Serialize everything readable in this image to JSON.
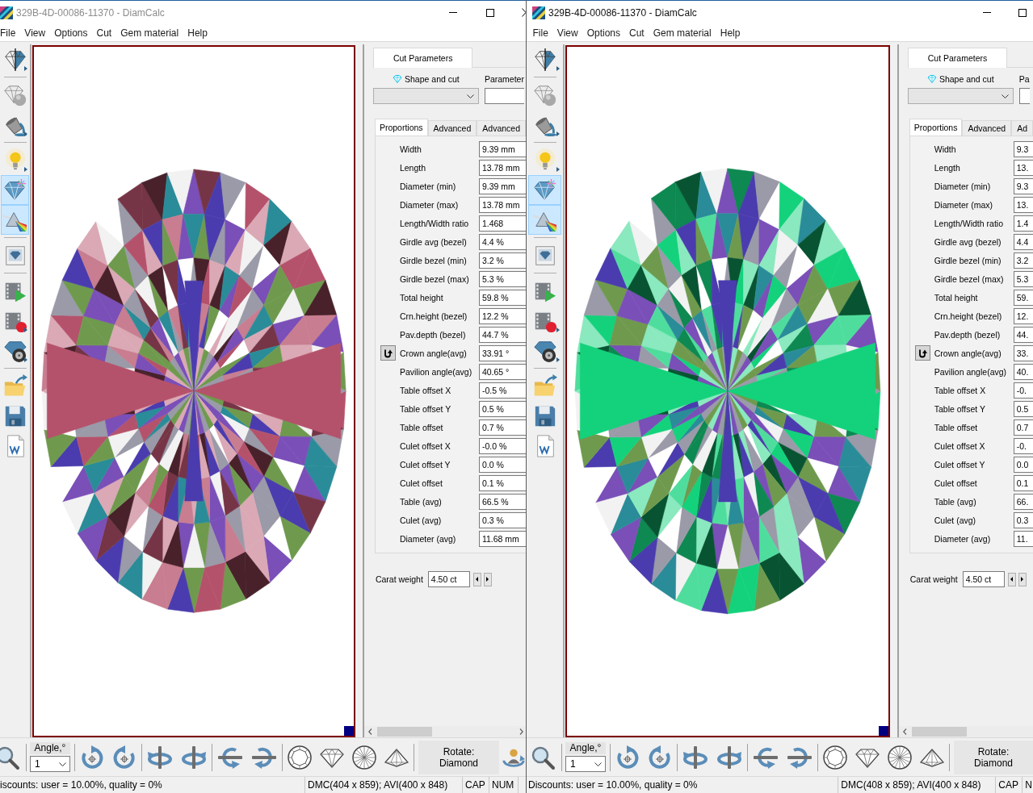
{
  "windows": [
    {
      "title": "329B-4D-00086-11370 - DiamCalc",
      "active": false,
      "menu": [
        "File",
        "View",
        "Options",
        "Cut",
        "Gem material",
        "Help"
      ],
      "tools": [
        {
          "selected": false,
          "menu": true
        },
        {
          "selected": false,
          "menu": false
        },
        {
          "selected": false,
          "menu": true
        },
        {
          "selected": false,
          "menu": true
        },
        {
          "selected": true,
          "menu": false
        },
        {
          "selected": true,
          "menu": false
        },
        {
          "selected": false,
          "menu": false
        },
        {
          "selected": false,
          "menu": false
        },
        {
          "selected": false,
          "menu": true
        },
        {
          "selected": false,
          "menu": true
        },
        {
          "selected": false,
          "menu": false
        },
        {
          "selected": false,
          "menu": false
        },
        {
          "selected": false,
          "menu": false
        }
      ],
      "view": {
        "color": "#b5526b"
      },
      "panel": {
        "top_tabs": [
          {
            "label": "Cut Parameters",
            "selected": true
          }
        ],
        "shape_label": "Shape and cut",
        "parameter_label": "Parameter",
        "tabs": [
          {
            "label": "Proportions",
            "selected": true
          },
          {
            "label": "Advanced",
            "selected": false
          },
          {
            "label": "Advanced",
            "selected": false
          }
        ],
        "rows": [
          {
            "kind": "field",
            "label": "Width",
            "value": "9.39 mm"
          },
          {
            "kind": "field",
            "label": "Length",
            "value": "13.78 mm"
          },
          {
            "kind": "field",
            "label": "Diameter (min)",
            "value": "9.39 mm"
          },
          {
            "kind": "field",
            "label": "Diameter (max)",
            "value": "13.78 mm"
          },
          {
            "kind": "field",
            "label": "Length/Width ratio",
            "value": "1.468"
          },
          {
            "kind": "field",
            "label": "Girdle avg (bezel)",
            "value": "4.4 %"
          },
          {
            "kind": "field",
            "label": "Girdle bezel (min)",
            "value": "3.2 %"
          },
          {
            "kind": "field",
            "label": "Girdle bezel (max)",
            "value": "5.3 %"
          },
          {
            "kind": "field",
            "label": "Total height",
            "value": "59.8 %"
          },
          {
            "kind": "field",
            "label": "Crn.height (bezel)",
            "value": "12.2 %"
          },
          {
            "kind": "field",
            "label": "Pav.depth (bezel)",
            "value": "44.7 %"
          },
          {
            "kind": "button-field",
            "label": "Crown angle(avg)",
            "value": "33.91 °"
          },
          {
            "kind": "field",
            "label": "Pavilion angle(avg)",
            "value": "40.65 °"
          },
          {
            "kind": "field",
            "label": "Table offset X",
            "value": "-0.5 %"
          },
          {
            "kind": "field",
            "label": "Table offset Y",
            "value": "0.5 %"
          },
          {
            "kind": "field",
            "label": "Table offset",
            "value": "0.7 %"
          },
          {
            "kind": "field",
            "label": "Culet offset X",
            "value": "-0.0 %"
          },
          {
            "kind": "field",
            "label": "Culet offset Y",
            "value": "0.0 %"
          },
          {
            "kind": "field",
            "label": "Culet offset",
            "value": "0.1 %"
          },
          {
            "kind": "field",
            "label": "Table (avg)",
            "value": "66.5 %"
          },
          {
            "kind": "field",
            "label": "Culet (avg)",
            "value": "0.3 %"
          },
          {
            "kind": "field",
            "label": "Diameter (avg)",
            "value": "11.68 mm"
          }
        ],
        "carat": {
          "label": "Carat weight",
          "value": "4.50 ct"
        }
      },
      "toolbar": {
        "angle_label": "Angle,°",
        "angle_value": "1",
        "rotate_label": "Rotate:",
        "rotate_value": "Diamond"
      },
      "status": {
        "message": "iscounts: user = 10.00%, quality = 0%",
        "size": "DMC(404 x 859); AVI(400 x 848)",
        "caps": "CAP",
        "num": "NUM"
      }
    },
    {
      "title": "329B-4D-00086-11370 - DiamCalc",
      "active": true,
      "menu": [
        "File",
        "View",
        "Options",
        "Cut",
        "Gem material",
        "Help"
      ],
      "tools": [
        {
          "selected": false,
          "menu": true
        },
        {
          "selected": false,
          "menu": false
        },
        {
          "selected": false,
          "menu": true
        },
        {
          "selected": false,
          "menu": true
        },
        {
          "selected": true,
          "menu": false
        },
        {
          "selected": true,
          "menu": false
        },
        {
          "selected": false,
          "menu": false
        },
        {
          "selected": false,
          "menu": false
        },
        {
          "selected": false,
          "menu": true
        },
        {
          "selected": false,
          "menu": true
        },
        {
          "selected": false,
          "menu": false
        },
        {
          "selected": false,
          "menu": false
        },
        {
          "selected": false,
          "menu": false
        }
      ],
      "view": {
        "color": "#14d27c"
      },
      "panel": {
        "top_tabs": [
          {
            "label": "Cut Parameters",
            "selected": true
          }
        ],
        "shape_label": "Shape and cut",
        "parameter_label": "Pa",
        "tabs": [
          {
            "label": "Proportions",
            "selected": true
          },
          {
            "label": "Advanced",
            "selected": false
          },
          {
            "label": "Ad",
            "selected": false
          }
        ],
        "rows": [
          {
            "kind": "field",
            "label": "Width",
            "value": "9.3"
          },
          {
            "kind": "field",
            "label": "Length",
            "value": "13."
          },
          {
            "kind": "field",
            "label": "Diameter (min)",
            "value": "9.3"
          },
          {
            "kind": "field",
            "label": "Diameter (max)",
            "value": "13."
          },
          {
            "kind": "field",
            "label": "Length/Width ratio",
            "value": "1.4"
          },
          {
            "kind": "field",
            "label": "Girdle avg (bezel)",
            "value": "4.4"
          },
          {
            "kind": "field",
            "label": "Girdle bezel (min)",
            "value": "3.2"
          },
          {
            "kind": "field",
            "label": "Girdle bezel (max)",
            "value": "5.3"
          },
          {
            "kind": "field",
            "label": "Total height",
            "value": "59."
          },
          {
            "kind": "field",
            "label": "Crn.height (bezel)",
            "value": "12."
          },
          {
            "kind": "field",
            "label": "Pav.depth (bezel)",
            "value": "44."
          },
          {
            "kind": "button-field",
            "label": "Crown angle(avg)",
            "value": "33."
          },
          {
            "kind": "field",
            "label": "Pavilion angle(avg)",
            "value": "40."
          },
          {
            "kind": "field",
            "label": "Table offset X",
            "value": "-0."
          },
          {
            "kind": "field",
            "label": "Table offset Y",
            "value": "0.5"
          },
          {
            "kind": "field",
            "label": "Table offset",
            "value": "0.7"
          },
          {
            "kind": "field",
            "label": "Culet offset X",
            "value": "-0."
          },
          {
            "kind": "field",
            "label": "Culet offset Y",
            "value": "0.0"
          },
          {
            "kind": "field",
            "label": "Culet offset",
            "value": "0.1"
          },
          {
            "kind": "field",
            "label": "Table (avg)",
            "value": "66."
          },
          {
            "kind": "field",
            "label": "Culet (avg)",
            "value": "0.3"
          },
          {
            "kind": "field",
            "label": "Diameter (avg)",
            "value": "11."
          }
        ],
        "carat": {
          "label": "Carat weight",
          "value": "4.50 ct"
        }
      },
      "toolbar": {
        "angle_label": "Angle,°",
        "angle_value": "1",
        "rotate_label": "Rotate:",
        "rotate_value": "Diamond"
      },
      "status": {
        "message": "Discounts: user = 10.00%, quality = 0%",
        "size": "DMC(408 x 859); AVI(400 x 848)",
        "caps": "CAP",
        "num": "N"
      }
    }
  ]
}
